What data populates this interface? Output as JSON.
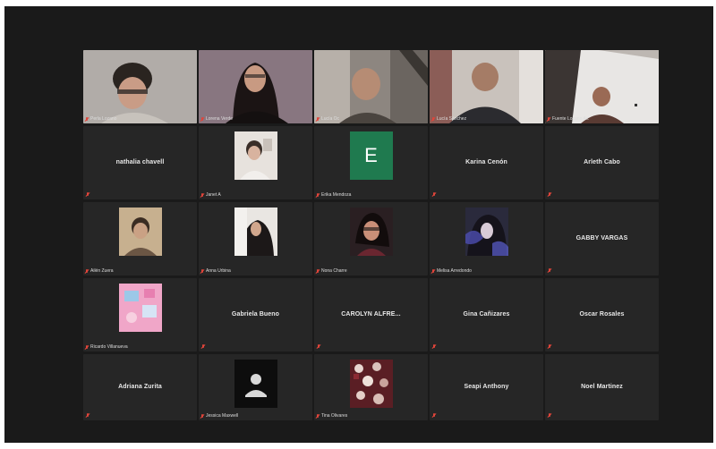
{
  "colors": {
    "window_bg": "#1a1a1a",
    "tile_bg": "#262626",
    "active_speaker": "#9fd06a",
    "muted_mic": "#e0453a",
    "e_avatar": "#1f7a4f"
  },
  "tiles": [
    {
      "type": "video",
      "label": "Perla Lozano",
      "muted": true,
      "active": false
    },
    {
      "type": "video",
      "label": "Lorena Verde",
      "muted": true,
      "active": false
    },
    {
      "type": "video",
      "label": "Lucía Oc",
      "muted": true,
      "active": false
    },
    {
      "type": "video",
      "label": "Lucía Sánchez",
      "muted": true,
      "active": false
    },
    {
      "type": "video",
      "label": "Fuente Lozano Av.",
      "muted": true,
      "active": true
    },
    {
      "type": "name",
      "title": "nathalia chavell",
      "muted": true
    },
    {
      "type": "photo",
      "label": "Janet A",
      "muted": true
    },
    {
      "type": "letter",
      "letter": "E",
      "label": "Erika Mendoza",
      "muted": true
    },
    {
      "type": "name",
      "title": "Karina Cenón",
      "muted": true
    },
    {
      "type": "name",
      "title": "Arleth Cabo",
      "muted": true
    },
    {
      "type": "photo",
      "label": "Ailén Zuera",
      "muted": true
    },
    {
      "type": "photo",
      "label": "Anna Urbina",
      "muted": true
    },
    {
      "type": "photo",
      "label": "Nona Charre",
      "muted": true
    },
    {
      "type": "photo",
      "label": "Melisa Arredondo",
      "muted": true
    },
    {
      "type": "name",
      "title": "GABBY VARGAS",
      "muted": true
    },
    {
      "type": "photo",
      "label": "Ricardo Villanueva",
      "muted": true
    },
    {
      "type": "name",
      "title": "Gabriela Bueno",
      "muted": true
    },
    {
      "type": "name",
      "title": "CAROLYN ALFRE...",
      "muted": true
    },
    {
      "type": "name",
      "title": "Gina Cañizares",
      "muted": true
    },
    {
      "type": "name",
      "title": "Oscar Rosales",
      "muted": true
    },
    {
      "type": "name",
      "title": "Adriana Zurita",
      "muted": true
    },
    {
      "type": "person",
      "label": "Jessica Maxwell",
      "muted": true
    },
    {
      "type": "photo",
      "label": "Tina Olivares",
      "muted": true
    },
    {
      "type": "name",
      "title": "Seapi Anthony",
      "muted": true
    },
    {
      "type": "name",
      "title": "Noel Martinez",
      "muted": true
    }
  ]
}
